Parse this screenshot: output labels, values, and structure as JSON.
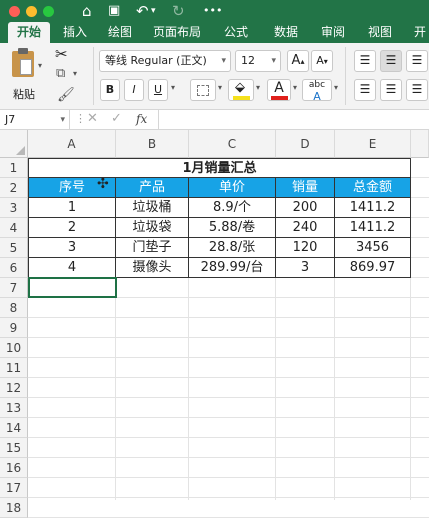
{
  "tabs": {
    "home": "开始",
    "insert": "插入",
    "draw": "绘图",
    "layout": "页面布局",
    "formulas": "公式",
    "data": "数据",
    "review": "审阅",
    "view": "视图",
    "more": "开"
  },
  "ribbon": {
    "paste_label": "粘贴",
    "font_name": "等线 Regular (正文)",
    "font_size": "12",
    "bold": "B",
    "italic": "I",
    "underline": "U",
    "increase_font": "A",
    "decrease_font": "A",
    "phonetic": "abc",
    "font_color": "A",
    "fill_color_hex": "#f5e11d",
    "font_color_hex": "#e0201b"
  },
  "formula_bar": {
    "cell_ref": "J7",
    "fx": "fx",
    "value": ""
  },
  "grid": {
    "columns": [
      "A",
      "B",
      "C",
      "D",
      "E"
    ],
    "rows": [
      "1",
      "2",
      "3",
      "4",
      "5",
      "6",
      "7",
      "8",
      "9",
      "10",
      "11",
      "12",
      "13",
      "14",
      "15",
      "16",
      "17",
      "18"
    ],
    "title": "1月销量汇总",
    "headers": [
      "序号",
      "产品",
      "单价",
      "销量",
      "总金额"
    ],
    "data": [
      [
        "1",
        "垃圾桶",
        "8.9/个",
        "200",
        "1411.2"
      ],
      [
        "2",
        "垃圾袋",
        "5.88/卷",
        "240",
        "1411.2"
      ],
      [
        "3",
        "门垫子",
        "28.8/张",
        "120",
        "3456"
      ],
      [
        "4",
        "摄像头",
        "289.99/台",
        "3",
        "869.97"
      ]
    ],
    "header_fill": "#17a3e6"
  }
}
